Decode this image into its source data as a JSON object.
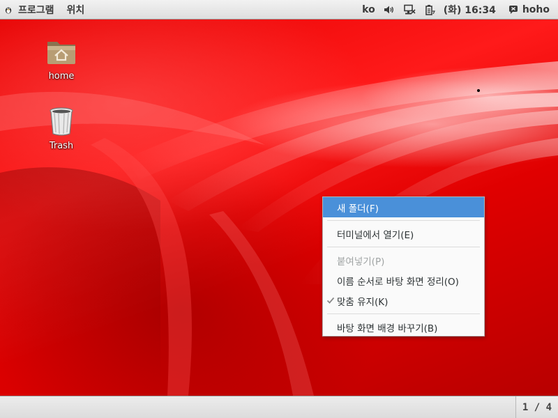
{
  "top_panel": {
    "applications_label": "프로그램",
    "places_label": "위치",
    "keyboard_layout": "ko",
    "clock": "(화) 16:34",
    "user_name": "hoho",
    "icons": [
      "applications-logo-icon",
      "volume-icon",
      "network-icon",
      "battery-icon",
      "chat-icon"
    ]
  },
  "desktop": {
    "icons": [
      {
        "label": "home",
        "icon": "home-folder-icon"
      },
      {
        "label": "Trash",
        "icon": "trash-icon"
      }
    ]
  },
  "context_menu": {
    "items": [
      {
        "label": "새 폴더(F)",
        "state": "highlighted"
      },
      {
        "label": "터미널에서 열기(E)",
        "state": "normal"
      },
      {
        "label": "붙여넣기(P)",
        "state": "disabled"
      },
      {
        "label": "이름 순서로 바탕 화면 정리(O)",
        "state": "normal"
      },
      {
        "label": "맞춤 유지(K)",
        "state": "checked"
      },
      {
        "label": "바탕 화면 배경 바꾸기(B)",
        "state": "normal"
      }
    ]
  },
  "bottom_panel": {
    "workspace_indicator": "1 / 4"
  },
  "colors": {
    "highlight": "#4a90d9",
    "wallpaper": "#e60000"
  }
}
